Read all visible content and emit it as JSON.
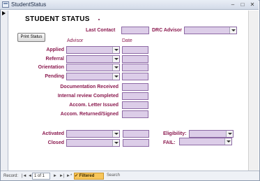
{
  "window": {
    "title": "StudentStatus",
    "min": "–",
    "max": "□",
    "close": "✕"
  },
  "header": {
    "title": "STUDENT STATUS"
  },
  "print_button": "Print Status",
  "last_contact": {
    "label": "Last Contact",
    "value": ""
  },
  "drc_advisor": {
    "label": "DRC Advisor",
    "value": ""
  },
  "columns": {
    "advisor": "Advisor",
    "date": "Date"
  },
  "rows": [
    {
      "label": "Applied",
      "advisor": "",
      "date": ""
    },
    {
      "label": "Referral",
      "advisor": "",
      "date": ""
    },
    {
      "label": "Orientation",
      "advisor": "",
      "date": ""
    },
    {
      "label": "Pending",
      "advisor": "",
      "date": ""
    }
  ],
  "doc_fields": [
    {
      "label": "Documentation Received",
      "value": ""
    },
    {
      "label": "Internal review Completed",
      "value": ""
    },
    {
      "label": "Accom. Letter Issued",
      "value": ""
    },
    {
      "label": "Accom. Returned/Signed",
      "value": ""
    }
  ],
  "activated": {
    "label": "Activated",
    "advisor": "",
    "date": ""
  },
  "closed": {
    "label": "Closed",
    "advisor": "",
    "date": ""
  },
  "eligibility": {
    "label": "Eligibility:",
    "value": ""
  },
  "fail": {
    "label": "FAIL:",
    "value": ""
  },
  "statusbar": {
    "record_label": "Record:",
    "first": "|◄",
    "prev": "◄",
    "record_value": "1 of 1",
    "next": "►",
    "last": "►|",
    "new": "►*",
    "filter_label": "Filtered",
    "search_label": "Search"
  }
}
